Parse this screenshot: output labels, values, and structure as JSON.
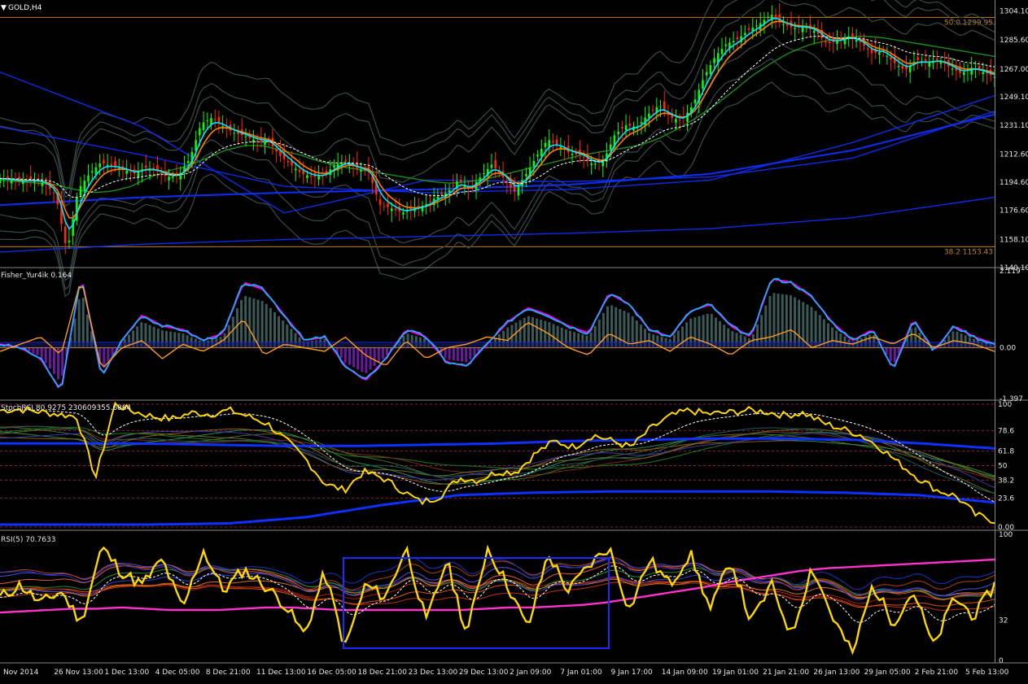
{
  "window": {
    "symbol_label": "GOLD,H4",
    "menu_glyph": "▼"
  },
  "colors": {
    "background": "#000000",
    "bull": "#00ff00",
    "bear": "#ff2a00",
    "ema_fast": "#00e5ff",
    "ema_mid": "#ff7f00",
    "ema_slow": "#1a8c1a",
    "band": "#3a4a4a",
    "blue_line": "#1030ff",
    "fib": "#c08020",
    "fisher_hist": "#3a5a5a",
    "fisher_neg": "#6a1aa0",
    "fisher_line1": "#ff00ff",
    "fisher_line2": "#00bfff",
    "yellow": "#ffd700",
    "orange": "#ff9a1a",
    "magenta": "#ff33cc",
    "grid": "#555555",
    "text": "#e6e6e6",
    "highlight_box": "#1a2cff"
  },
  "chart_data": [
    {
      "type": "candlestick",
      "name": "GOLD,H4",
      "ylim": [
        1140.1,
        1310.0
      ],
      "y_ticks": [
        "1304.10",
        "1285.60",
        "1267.00",
        "1249.10",
        "1231.10",
        "1212.60",
        "1194.60",
        "1176.60",
        "1158.10",
        "1140.10"
      ],
      "fib_levels": [
        {
          "label": "50.0 1299.95",
          "value": 1299.95
        },
        {
          "label": "38.2 1153.43",
          "value": 1153.43
        }
      ],
      "close_path": [
        1197,
        1196,
        1195,
        1196,
        1194,
        1186,
        1150,
        1190,
        1200,
        1207,
        1205,
        1203,
        1200,
        1204,
        1202,
        1198,
        1199,
        1210,
        1232,
        1236,
        1230,
        1226,
        1224,
        1221,
        1221,
        1212,
        1206,
        1200,
        1198,
        1199,
        1206,
        1208,
        1203,
        1201,
        1180,
        1178,
        1175,
        1178,
        1180,
        1185,
        1188,
        1196,
        1190,
        1198,
        1206,
        1198,
        1188,
        1199,
        1211,
        1222,
        1218,
        1213,
        1212,
        1206,
        1208,
        1225,
        1231,
        1230,
        1238,
        1244,
        1236,
        1234,
        1244,
        1262,
        1275,
        1283,
        1286,
        1292,
        1296,
        1302,
        1296,
        1293,
        1294,
        1291,
        1283,
        1285,
        1288,
        1284,
        1277,
        1278,
        1271,
        1266,
        1273,
        1271,
        1273,
        1268,
        1264,
        1268,
        1265,
        1262
      ],
      "ema_slow_path": [
        1196,
        1195,
        1194,
        1193,
        1190,
        1188,
        1189,
        1192,
        1198,
        1202,
        1205,
        1210,
        1215,
        1218,
        1218,
        1215,
        1212,
        1208,
        1205,
        1203,
        1201,
        1199,
        1197,
        1195,
        1194,
        1195,
        1197,
        1200,
        1203,
        1206,
        1209,
        1212,
        1214,
        1216,
        1218,
        1222,
        1228,
        1235,
        1243,
        1252,
        1262,
        1270,
        1277,
        1282,
        1285,
        1287,
        1288,
        1287,
        1285,
        1283,
        1281,
        1279,
        1277,
        1275
      ]
    },
    {
      "type": "line",
      "name": "Fisher_Yur4ik 0.164",
      "ylim": [
        -1.397,
        2.119
      ],
      "y_ticks": [
        "2.119",
        "0.00",
        "-1.397"
      ],
      "series": [
        {
          "values": [
            0.1,
            0.0,
            -0.3,
            -1.2,
            2.0,
            -0.8,
            0.2,
            0.9,
            0.6,
            0.5,
            0.2,
            0.4,
            1.8,
            1.6,
            0.9,
            0.2,
            0.3,
            -0.5,
            -0.9,
            -0.3,
            0.5,
            0.3,
            -0.4,
            -0.5,
            0.1,
            0.7,
            1.1,
            0.9,
            0.6,
            0.4,
            1.5,
            1.2,
            0.5,
            0.3,
            1.0,
            1.2,
            0.6,
            0.3,
            1.9,
            1.8,
            1.4,
            0.7,
            0.2,
            0.5,
            -0.6,
            0.8,
            -0.1,
            0.6,
            0.3,
            0.1
          ]
        },
        {
          "values": [
            -0.1,
            0.1,
            0.3,
            -0.2,
            1.9,
            -0.6,
            0.0,
            0.2,
            -0.3,
            0.1,
            -0.1,
            0.2,
            0.8,
            -0.2,
            0.1,
            0.0,
            -0.1,
            0.3,
            -0.2,
            -0.5,
            0.2,
            -0.3,
            0.0,
            0.1,
            0.3,
            0.2,
            0.7,
            0.4,
            0.0,
            -0.2,
            0.4,
            0.1,
            0.2,
            -0.1,
            0.3,
            0.1,
            -0.2,
            0.2,
            0.3,
            0.5,
            0.0,
            0.2,
            0.1,
            0.3,
            0.1,
            0.4,
            0.0,
            0.2,
            0.1,
            -0.1
          ]
        }
      ]
    },
    {
      "type": "line",
      "name": "StochRSI 80.9275 230609355.6864",
      "ylim": [
        0,
        100
      ],
      "y_ticks": [
        "100",
        "78.6",
        "61.8",
        "50",
        "38.2",
        "23.6",
        "0.00"
      ],
      "series": [
        {
          "values": [
            95,
            96,
            94,
            92,
            90,
            40,
            100,
            94,
            90,
            88,
            93,
            92,
            95,
            90,
            84,
            70,
            55,
            35,
            30,
            45,
            40,
            30,
            20,
            25,
            40,
            38,
            45,
            45,
            60,
            70,
            65,
            75,
            70,
            65,
            80,
            90,
            95,
            92,
            93,
            95,
            94,
            91,
            93,
            85,
            80,
            75,
            65,
            52,
            40,
            30,
            25,
            10,
            5
          ]
        }
      ]
    },
    {
      "type": "line",
      "name": "RSI(5) 70.7633",
      "ylim": [
        0,
        100
      ],
      "y_ticks": [
        "100",
        "32",
        "0"
      ],
      "series": [
        {
          "values": [
            50,
            60,
            45,
            55,
            30,
            90,
            70,
            60,
            80,
            40,
            88,
            55,
            72,
            60,
            45,
            20,
            70,
            10,
            60,
            50,
            90,
            30,
            80,
            20,
            90,
            60,
            25,
            85,
            55,
            75,
            90,
            40,
            80,
            60,
            85,
            40,
            80,
            30,
            60,
            20,
            75,
            35,
            5,
            60,
            30,
            55,
            10,
            50,
            35,
            60
          ]
        },
        {
          "values": [
            38,
            39,
            40,
            41,
            41,
            42,
            41,
            40,
            40,
            40,
            41,
            42,
            42,
            41,
            40,
            40,
            40,
            40,
            40,
            40,
            41,
            42,
            42,
            43,
            44,
            46,
            49,
            52,
            55,
            58,
            62,
            65,
            68,
            71,
            73,
            74,
            75,
            76,
            77,
            78,
            79,
            80
          ]
        }
      ]
    }
  ],
  "x_axis": {
    "labels": [
      "Nov 2014",
      "26 Nov 13:00",
      "1 Dec 13:00",
      "4 Dec 05:00",
      "8 Dec 21:00",
      "11 Dec 13:00",
      "16 Dec 05:00",
      "18 Dec 21:00",
      "23 Dec 13:00",
      "29 Dec 13:00",
      "2 Jan 09:00",
      "7 Jan 01:00",
      "9 Jan 17:00",
      "14 Jan 09:00",
      "19 Jan 01:00",
      "21 Jan 21:00",
      "26 Jan 13:00",
      "29 Jan 05:00",
      "2 Feb 21:00",
      "5 Feb 13:00"
    ]
  }
}
